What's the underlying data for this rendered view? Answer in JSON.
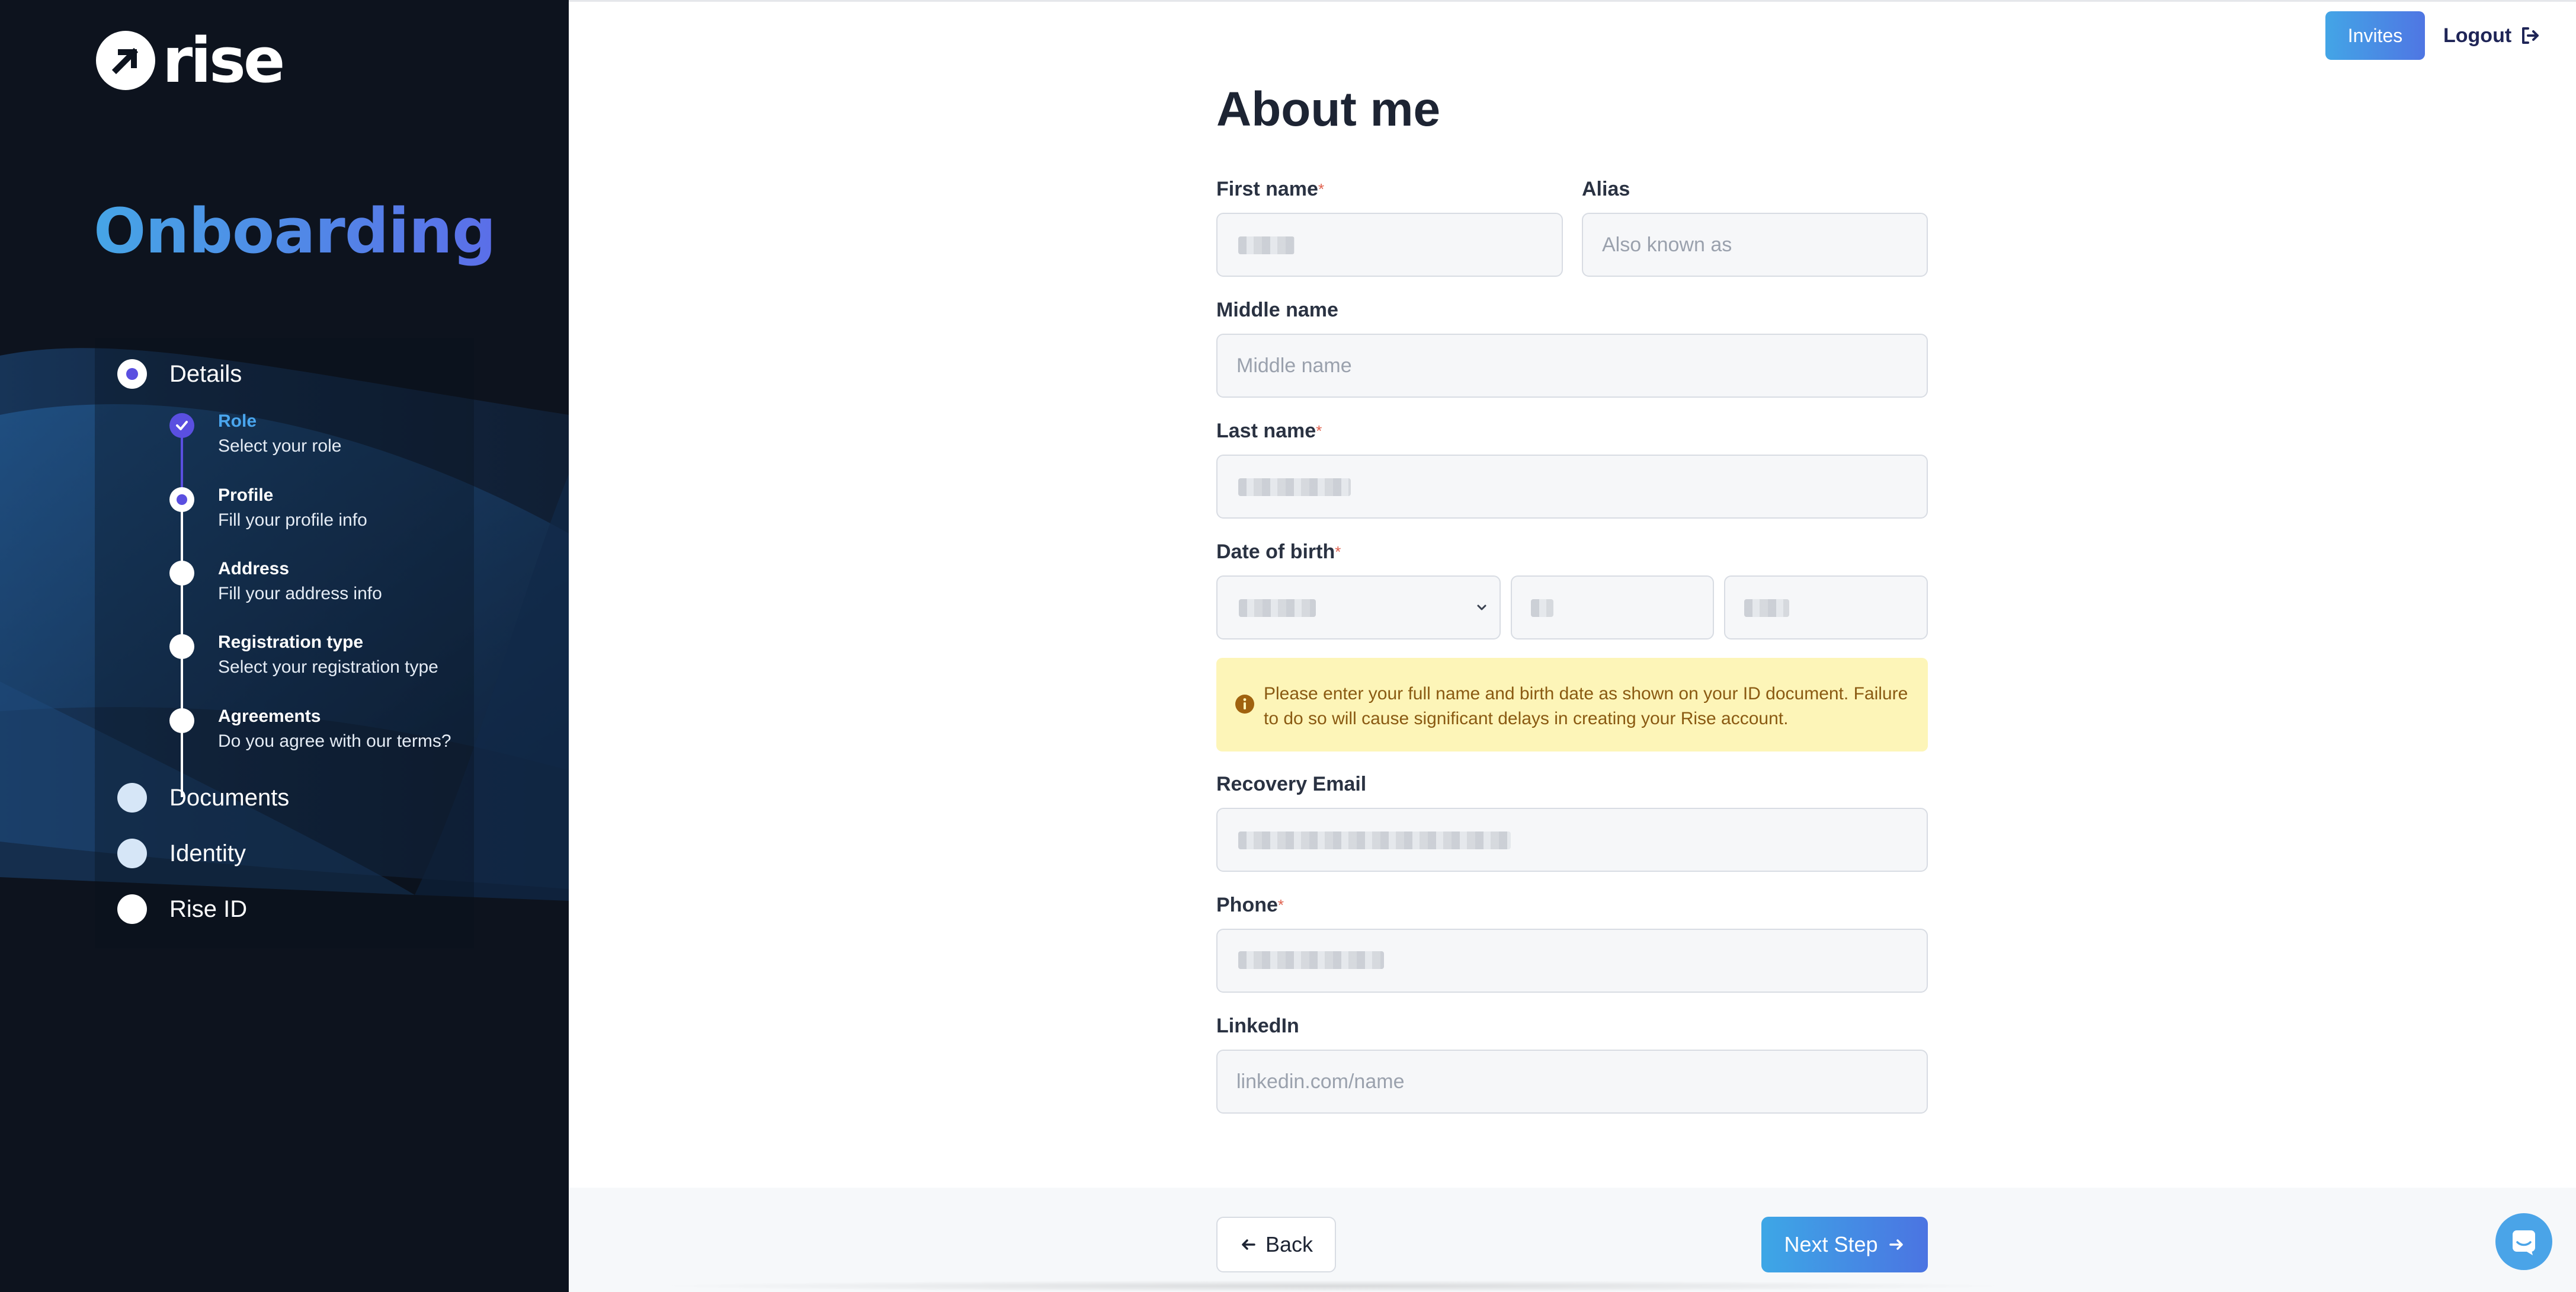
{
  "brand": {
    "name": "rise",
    "accent": "#5a4fe0",
    "gradient_start": "#43a5e6",
    "gradient_end": "#4f76e3"
  },
  "sidebar": {
    "title": "Onboarding",
    "steps": [
      {
        "label": "Details",
        "state": "active"
      },
      {
        "label": "Documents",
        "state": "pending"
      },
      {
        "label": "Identity",
        "state": "pending"
      },
      {
        "label": "Rise ID",
        "state": "pending"
      }
    ],
    "substeps": [
      {
        "title": "Role",
        "subtitle": "Select your role",
        "state": "done"
      },
      {
        "title": "Profile",
        "subtitle": "Fill your profile info",
        "state": "current"
      },
      {
        "title": "Address",
        "subtitle": "Fill your address info",
        "state": "pending"
      },
      {
        "title": "Registration type",
        "subtitle": "Select your registration type",
        "state": "pending"
      },
      {
        "title": "Agreements",
        "subtitle": "Do you agree with our terms?",
        "state": "pending"
      }
    ]
  },
  "header": {
    "invites_label": "Invites",
    "logout_label": "Logout"
  },
  "form": {
    "title": "About me",
    "required_mark": "*",
    "first_name": {
      "label": "First name",
      "value": ""
    },
    "alias": {
      "label": "Alias",
      "placeholder": "Also known as"
    },
    "middle_name": {
      "label": "Middle name",
      "placeholder": "Middle name"
    },
    "last_name": {
      "label": "Last name",
      "value": ""
    },
    "dob": {
      "label": "Date of birth"
    },
    "notice": "Please enter your full name and birth date as shown on your ID document. Failure to do so will cause significant delays in creating your Rise account.",
    "recovery_email": {
      "label": "Recovery Email"
    },
    "phone": {
      "label": "Phone"
    },
    "linkedin": {
      "label": "LinkedIn",
      "placeholder": "linkedin.com/name"
    }
  },
  "footer": {
    "back_label": "Back",
    "next_label": "Next Step"
  }
}
